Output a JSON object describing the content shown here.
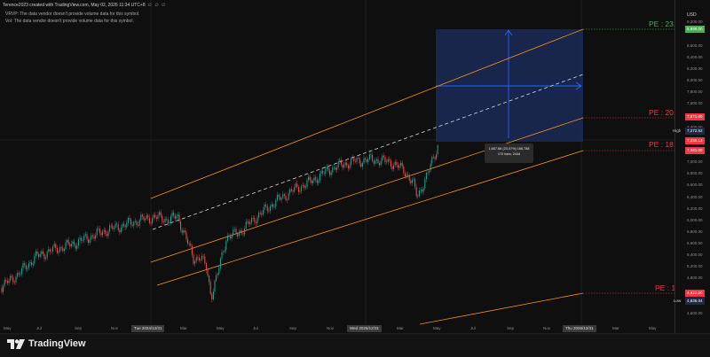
{
  "header": {
    "credit": "Terence2023 created with TradingView.com, May 02, 2026 11:34 UTC+8",
    "credit_dots": "∅ ∅ ∅",
    "notes": [
      "VRVP: The data vendor doesn't provide volume data for this symbol.",
      "Vol: The data vendor doesn't provide volume data for this symbol."
    ]
  },
  "price_axis": {
    "currency": "USD",
    "ticks": [
      "9,200.00",
      "9,000.00",
      "8,600.00",
      "8,400.00",
      "8,200.00",
      "8,000.00",
      "7,800.00",
      "7,600.00",
      "7,400.00",
      "7,000.00",
      "6,800.00",
      "6,600.00",
      "6,400.00",
      "6,200.00",
      "6,000.00",
      "5,800.00",
      "5,600.00",
      "5,400.00",
      "5,200.00",
      "4,800.00",
      "4,600.00"
    ],
    "markers": [
      {
        "value": "8,898.00",
        "color": "#4caf50"
      },
      {
        "value": "7,571.00",
        "color": "#f23645"
      },
      {
        "value": "7,272.52",
        "color": "#1e2a44",
        "name": "High"
      },
      {
        "value": "7,230.13",
        "color": "#f23645"
      },
      {
        "value": "7,081.00",
        "color": "#f23645"
      },
      {
        "value": "4,922.00",
        "color": "#f23645"
      },
      {
        "value": "4,835.04",
        "color": "#1e2a44",
        "name": "Low"
      }
    ]
  },
  "pe_labels": [
    {
      "text": "PE : 23.5",
      "color": "#4caf50"
    },
    {
      "text": "PE : 20.0",
      "color": "#f23645"
    },
    {
      "text": "PE : 18.7",
      "color": "#f23645"
    },
    {
      "text": "PE : 13",
      "color": "#f23645"
    }
  ],
  "tooltip": {
    "line1": "1,667.88 (23.07%) 166,788",
    "line2": "170 bars, 244d"
  },
  "time_axis": {
    "ticks": [
      "May",
      "Jul",
      "Sep",
      "Nov",
      "Mar",
      "May",
      "Jul",
      "Sep",
      "Nov",
      "Mar",
      "May",
      "Jul",
      "Sep",
      "Nov",
      "Mar",
      "May"
    ],
    "boxes": [
      "Tue 2024/12/31",
      "Wed 2025/12/31",
      "Thu 2026/12/31"
    ]
  },
  "footer": {
    "brand": "TradingView",
    "logo_icon": "tradingview-logo-icon"
  },
  "colors": {
    "candle_up": "#26a69a",
    "candle_down": "#ef5350",
    "channel": "#f7941d",
    "trend": "#d8d8d8",
    "projection_box": "#1c2c5a",
    "projection_arrow": "#2962ff"
  }
}
